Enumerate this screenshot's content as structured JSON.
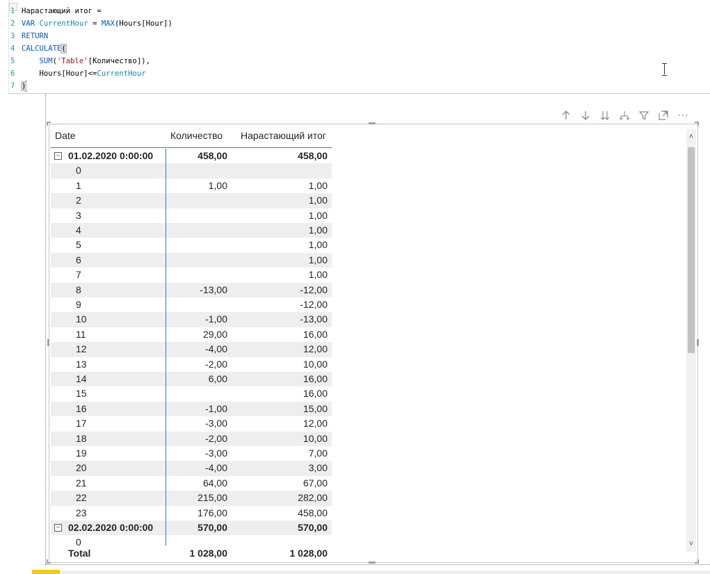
{
  "editor": {
    "lines": [
      {
        "num": "1",
        "parts": [
          {
            "t": "Нарастающий итог =",
            "c": ""
          }
        ]
      },
      {
        "num": "2",
        "parts": [
          {
            "t": "VAR ",
            "c": "kw"
          },
          {
            "t": "CurrentHour",
            "c": "var"
          },
          {
            "t": " = ",
            "c": ""
          },
          {
            "t": "MAX",
            "c": "kw"
          },
          {
            "t": "(Hours[Hour])",
            "c": ""
          }
        ]
      },
      {
        "num": "3",
        "parts": [
          {
            "t": "RETURN",
            "c": "kw"
          }
        ]
      },
      {
        "num": "4",
        "parts": [
          {
            "t": "CALCULATE",
            "c": "kw"
          },
          {
            "t": "(",
            "c": "bracket-hl"
          }
        ]
      },
      {
        "num": "5",
        "parts": [
          {
            "t": "    ",
            "c": ""
          },
          {
            "t": "SUM",
            "c": "kw"
          },
          {
            "t": "(",
            "c": ""
          },
          {
            "t": "'Table'",
            "c": "str"
          },
          {
            "t": "[Количество]),",
            "c": ""
          }
        ]
      },
      {
        "num": "6",
        "parts": [
          {
            "t": "    Hours[Hour]<=",
            "c": ""
          },
          {
            "t": "CurrentHour",
            "c": "var"
          }
        ]
      },
      {
        "num": "7",
        "parts": [
          {
            "t": ")",
            "c": "bracket-hl"
          }
        ]
      }
    ]
  },
  "toolbar": {
    "icons": [
      "arrow-up-icon",
      "arrow-down-icon",
      "double-arrow-down-icon",
      "expand-hierarchy-icon",
      "filter-icon",
      "focus-mode-icon",
      "more-options-icon"
    ],
    "more_label": "···"
  },
  "table": {
    "headers": {
      "date": "Date",
      "qty": "Количество",
      "running": "Нарастающий итог"
    },
    "group1": {
      "label": "01.02.2020 0:00:00",
      "qty": "458,00",
      "running": "458,00",
      "expander": "−"
    },
    "rows": [
      {
        "h": "0",
        "q": "",
        "r": ""
      },
      {
        "h": "1",
        "q": "1,00",
        "r": "1,00"
      },
      {
        "h": "2",
        "q": "",
        "r": "1,00"
      },
      {
        "h": "3",
        "q": "",
        "r": "1,00"
      },
      {
        "h": "4",
        "q": "",
        "r": "1,00"
      },
      {
        "h": "5",
        "q": "",
        "r": "1,00"
      },
      {
        "h": "6",
        "q": "",
        "r": "1,00"
      },
      {
        "h": "7",
        "q": "",
        "r": "1,00"
      },
      {
        "h": "8",
        "q": "-13,00",
        "r": "-12,00"
      },
      {
        "h": "9",
        "q": "",
        "r": "-12,00"
      },
      {
        "h": "10",
        "q": "-1,00",
        "r": "-13,00"
      },
      {
        "h": "11",
        "q": "29,00",
        "r": "16,00"
      },
      {
        "h": "12",
        "q": "-4,00",
        "r": "12,00"
      },
      {
        "h": "13",
        "q": "-2,00",
        "r": "10,00"
      },
      {
        "h": "14",
        "q": "6,00",
        "r": "16,00"
      },
      {
        "h": "15",
        "q": "",
        "r": "16,00"
      },
      {
        "h": "16",
        "q": "-1,00",
        "r": "15,00"
      },
      {
        "h": "17",
        "q": "-3,00",
        "r": "12,00"
      },
      {
        "h": "18",
        "q": "-2,00",
        "r": "10,00"
      },
      {
        "h": "19",
        "q": "-3,00",
        "r": "7,00"
      },
      {
        "h": "20",
        "q": "-4,00",
        "r": "3,00"
      },
      {
        "h": "21",
        "q": "64,00",
        "r": "67,00"
      },
      {
        "h": "22",
        "q": "215,00",
        "r": "282,00"
      },
      {
        "h": "23",
        "q": "176,00",
        "r": "458,00"
      }
    ],
    "group2": {
      "label": "02.02.2020 0:00:00",
      "qty": "570,00",
      "running": "570,00",
      "expander": "−"
    },
    "group2_first_row": {
      "h": "0"
    },
    "total": {
      "label": "Total",
      "qty": "1 028,00",
      "running": "1 028,00"
    }
  },
  "scrollbar": {
    "up": "˄",
    "down": "˅"
  }
}
